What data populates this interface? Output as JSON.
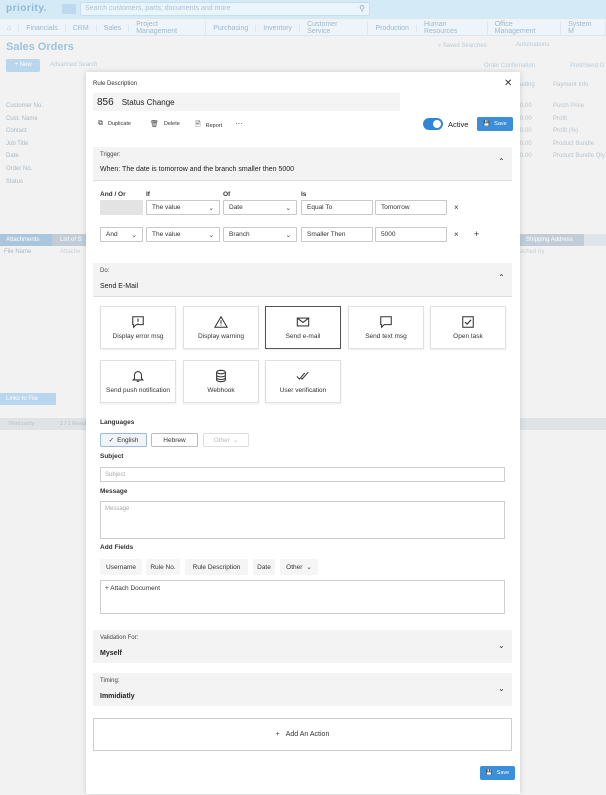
{
  "app": {
    "logo": "priority.",
    "search_placeholder": "Search customers, parts, documents and more",
    "nav": [
      "Financials",
      "CRM",
      "Sales",
      "Project Management",
      "Purchasing",
      "Inventory",
      "Customer Service",
      "Production",
      "Human Resources",
      "Office Management",
      "System M"
    ],
    "page_title": "Sales Orders",
    "saved_searches": "Saved Searches",
    "automations": "Automations",
    "new_label": "New",
    "advanced_search": "Advanced Search",
    "order_confirmation": "Order Confirmation",
    "print_send": "Print/Send O",
    "side_fields": [
      "Customer No.",
      "Cust. Name",
      "Contact",
      "Job Title",
      "Date",
      "Order No.",
      "Status"
    ],
    "right_headers": [
      "uding",
      "Payment Info"
    ],
    "right_values": [
      "0.00",
      "0.00",
      "0.00",
      "0.00",
      "0.00"
    ],
    "right_fields": [
      "Purch Price",
      "Profit",
      "Profit (%)",
      "Product Bundle",
      "Product Bundle Qty"
    ],
    "tab_attachments": "Attachments",
    "tab_list": "List of S",
    "tab_shipping": "Shipping Address",
    "file_name": "File Name",
    "attached": "Attache",
    "attached_by": "ached by",
    "links_to_file": "Links to File",
    "third_party": "Third party",
    "pager": "1 / 1 Results"
  },
  "modal": {
    "header": "Rule Description",
    "rule_number": "856",
    "rule_name": "Status Change",
    "toolbar": {
      "duplicate": "Duplicate",
      "delete": "Delete",
      "report": "Report",
      "more": "···"
    },
    "active_label": "Active",
    "save_label": "Save",
    "trigger": {
      "label": "Trigger:",
      "value": "When: The date is tomorrow and the branch smaller then 5000",
      "headers": {
        "andor": "And / Or",
        "if": "If",
        "of": "Of",
        "is": "Is"
      },
      "rows": [
        {
          "andor": "",
          "if": "The value",
          "of": "Date",
          "is": "Equal To",
          "value": "Tomorrow"
        },
        {
          "andor": "And",
          "if": "The value",
          "of": "Branch",
          "is": "Smaller Then",
          "value": "5000"
        }
      ]
    },
    "do": {
      "label": "Do:",
      "value": "Send E-Mail",
      "actions": [
        "Display error msg",
        "Display warning",
        "Send e-mail",
        "Send text msg",
        "Open task",
        "Send push notification",
        "Webhook",
        "User verification"
      ],
      "selected_action": "Send e-mail"
    },
    "languages": {
      "label": "Languages",
      "options": [
        "English",
        "Hebrew",
        "Other"
      ]
    },
    "subject": {
      "label": "Subject",
      "placeholder": "Subject"
    },
    "message": {
      "label": "Message",
      "placeholder": "Message"
    },
    "add_fields": {
      "label": "Add Fields",
      "fields": [
        "Username",
        "Rule No.",
        "Rule Description",
        "Date",
        "Other"
      ]
    },
    "attach_document": "Attach Document",
    "validation": {
      "label": "Validation For:",
      "value": "Myself"
    },
    "timing": {
      "label": "Timing:",
      "value": "Immidiatly"
    },
    "add_action": "Add An Action"
  },
  "colors": {
    "accent": "#3b8fd9",
    "toggle": "#2f86d6"
  }
}
